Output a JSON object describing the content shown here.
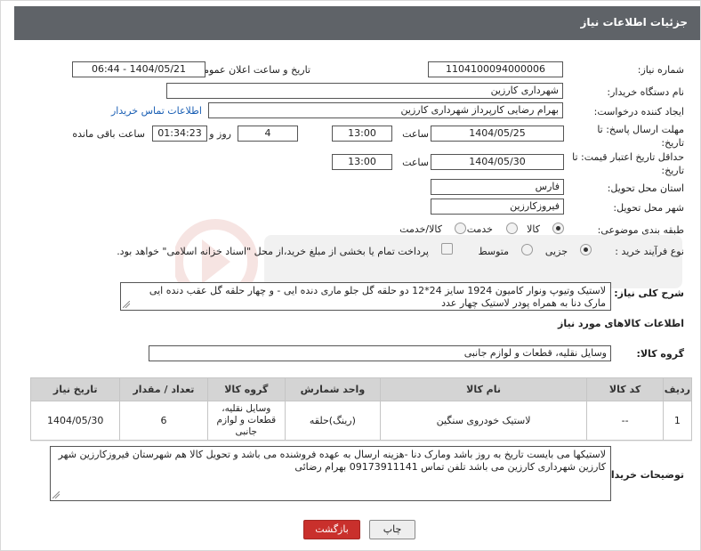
{
  "header": {
    "title": "جزئیات اطلاعات نیاز"
  },
  "fields": {
    "need_number_label": "شماره نیاز:",
    "need_number": "1104100094000006",
    "announce_label": "تاریخ و ساعت اعلان عمومی:",
    "announce_value": "1404/05/21 - 06:44",
    "buyer_org_label": "نام دستگاه خریدار:",
    "buyer_org": "شهرداری کارزین",
    "requester_label": "ایجاد کننده درخواست:",
    "requester": "بهرام رضایی کارپرداز شهرداری کارزین",
    "contact_link": "اطلاعات تماس خریدار",
    "deadline_label": "مهلت ارسال پاسخ: تا تاریخ:",
    "deadline_date": "1404/05/25",
    "time_label": "ساعت",
    "deadline_time": "13:00",
    "days_value": "4",
    "days_label": "روز و",
    "remaining_time": "01:34:23",
    "remaining_label": "ساعت باقی مانده",
    "validity_label": "حداقل تاریخ اعتبار قیمت: تا تاریخ:",
    "validity_date": "1404/05/30",
    "validity_time_label": "ساعت",
    "validity_time": "13:00",
    "province_label": "استان محل تحویل:",
    "province": "فارس",
    "city_label": "شهر محل تحویل:",
    "city": "فیروزکارزین",
    "category_label": "طبقه بندی موضوعی:",
    "category_options": [
      "کالا",
      "خدمت",
      "کالا/خدمت"
    ],
    "category_selected": "کالا",
    "purchase_type_label": "نوع فرآیند خرید :",
    "purchase_type_options": [
      "جزیی",
      "متوسط"
    ],
    "purchase_type_selected": "جزیی",
    "payment_note": "پرداخت تمام یا بخشی از مبلغ خرید،از محل \"اسناد خزانه اسلامی\" خواهد بود.",
    "description_label": "شرح کلی نیاز:",
    "description": "لاستیک وتیوپ ونوار کامیون 1924  سایز 24*12 دو حلقه گل جلو ماری دنده ایی - و چهار حلقه گل عقب دنده ایی مارک دنا به همراه پودر لاستیک چهار عدد"
  },
  "goods_section": {
    "title": "اطلاعات کالاهای مورد نیاز",
    "group_label": "گروه کالا:",
    "group_value": "وسایل نقلیه، قطعات و لوازم جانبی"
  },
  "table": {
    "headers": [
      "ردیف",
      "کد کالا",
      "نام کالا",
      "واحد شمارش",
      "گروه کالا",
      "تعداد / مقدار",
      "تاریخ نیاز"
    ],
    "rows": [
      [
        "1",
        "--",
        "لاستیک خودروی سنگین",
        "(رینگ)حلقه",
        "وسایل نقلیه، قطعات و لوازم جانبی",
        "6",
        "1404/05/30"
      ]
    ]
  },
  "buyer_notes": {
    "label": "توضیحات خریدار:",
    "text": "لاستیکها می بایست تاریخ به روز باشد ومارک دنا -هزینه ارسال به عهده فروشنده می باشد و تحویل کالا هم شهرستان فیروزکارزین شهر کارزین شهرداری کارزین می باشد تلفن تماس 09173911141 بهرام رضائی"
  },
  "buttons": {
    "print": "چاپ",
    "back": "بازگشت"
  },
  "colors": {
    "header_bg": "#5f6368",
    "back_button_bg": "#c9302c",
    "link": "#1a5fb4"
  }
}
